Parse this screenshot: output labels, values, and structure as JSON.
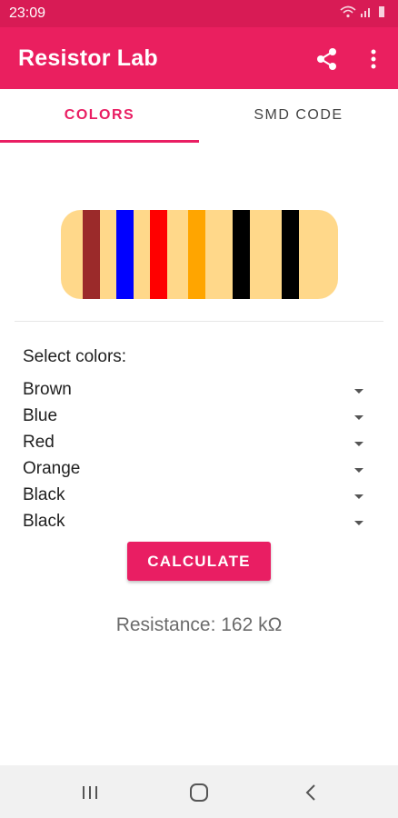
{
  "status_bar": {
    "time": "23:09"
  },
  "app_bar": {
    "title": "Resistor Lab",
    "share_icon": "share-icon",
    "more_icon": "more-vert-icon"
  },
  "tabs": [
    {
      "label": "COLORS",
      "selected": true
    },
    {
      "label": "SMD CODE",
      "selected": false
    }
  ],
  "resistor": {
    "bands": [
      {
        "name": "Brown",
        "color": "#9b2a2a"
      },
      {
        "name": "Blue",
        "color": "#0000ff"
      },
      {
        "name": "Red",
        "color": "#ff0000"
      },
      {
        "name": "Orange",
        "color": "#ffa500"
      },
      {
        "name": "Black",
        "color": "#000000"
      },
      {
        "name": "Black",
        "color": "#000000"
      }
    ],
    "body_color": "#ffd88a"
  },
  "form": {
    "label": "Select colors:",
    "selects": [
      "Brown",
      "Blue",
      "Red",
      "Orange",
      "Black",
      "Black"
    ],
    "button_label": "CALCULATE"
  },
  "result": {
    "text": "Resistance: 162 kΩ"
  },
  "colors": {
    "primary": "#e91e63",
    "status_bar": "#d81b55"
  }
}
